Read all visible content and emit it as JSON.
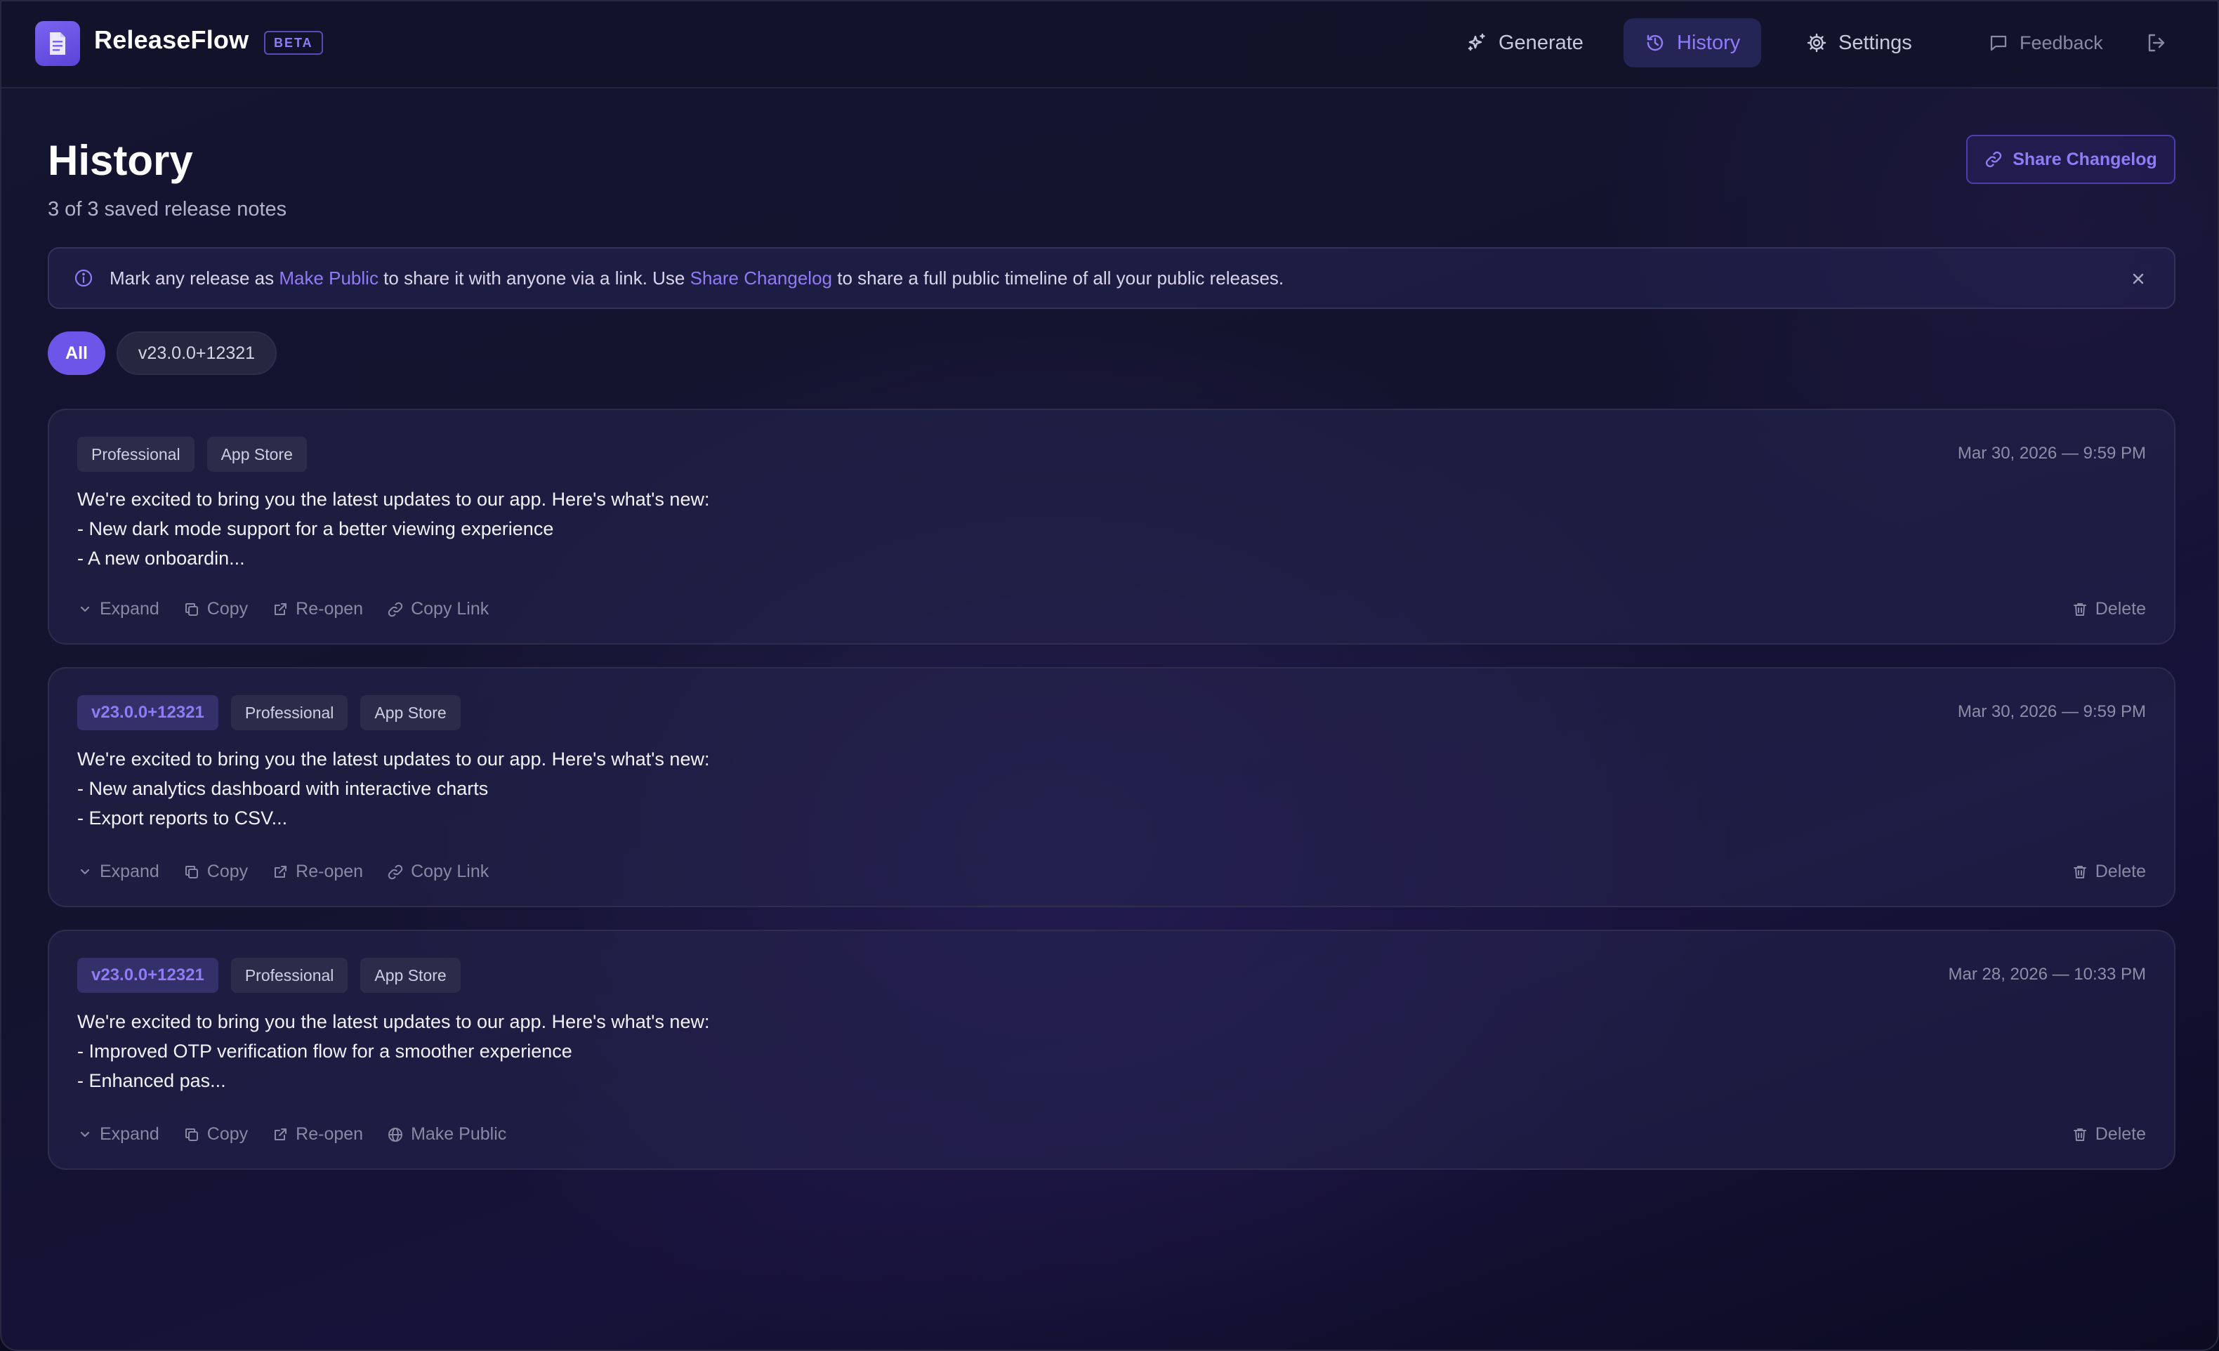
{
  "app": {
    "brand": "ReleaseFlow",
    "badge": "BETA"
  },
  "nav": {
    "generate": "Generate",
    "history": "History",
    "settings": "Settings",
    "feedback": "Feedback"
  },
  "page": {
    "title": "History",
    "subtitle": "3 of 3 saved release notes",
    "share_button": "Share Changelog"
  },
  "banner": {
    "text_1": "Mark any release as ",
    "link_1": "Make Public",
    "text_2": " to share it with anyone via a link. Use ",
    "link_2": "Share Changelog",
    "text_3": " to share a full public timeline of all your public releases."
  },
  "filters": {
    "all": "All",
    "version": "v23.0.0+12321"
  },
  "releases": [
    {
      "tags": [
        "Professional",
        "App Store"
      ],
      "date": "Mar 30, 2026 — 9:59 PM",
      "lines": [
        "We're excited to bring you the latest updates to our app. Here's what's new:",
        "- New dark mode support for a better viewing experience",
        "- A new onboardin..."
      ],
      "actions": [
        "Expand",
        "Copy",
        "Re-open",
        "Copy Link"
      ],
      "delete": "Delete"
    },
    {
      "version": "v23.0.0+12321",
      "tags": [
        "Professional",
        "App Store"
      ],
      "date": "Mar 30, 2026 — 9:59 PM",
      "lines": [
        "We're excited to bring you the latest updates to our app. Here's what's new:",
        "- New analytics dashboard with interactive charts",
        "- Export reports to CSV..."
      ],
      "actions": [
        "Expand",
        "Copy",
        "Re-open",
        "Copy Link"
      ],
      "delete": "Delete"
    },
    {
      "version": "v23.0.0+12321",
      "tags": [
        "Professional",
        "App Store"
      ],
      "date": "Mar 28, 2026 — 10:33 PM",
      "lines": [
        "We're excited to bring you the latest updates to our app. Here's what's new:",
        "- Improved OTP verification flow for a smoother experience",
        "- Enhanced pas..."
      ],
      "actions": [
        "Expand",
        "Copy",
        "Re-open",
        "Make Public"
      ],
      "delete": "Delete"
    }
  ],
  "colors": {
    "accent": "#6d55ea",
    "accent_text": "#8f7cf5",
    "background": "#141531"
  },
  "icons": {
    "logo": "document-icon",
    "generate": "sparkles-icon",
    "history": "history-icon",
    "settings": "gear-icon",
    "feedback": "message-icon",
    "logout": "logout-icon",
    "info": "info-icon",
    "close": "close-icon",
    "link": "link-icon",
    "expand": "chevron-down-icon",
    "copy": "copy-icon",
    "reopen": "external-link-icon",
    "public": "globe-icon",
    "delete": "trash-icon"
  }
}
